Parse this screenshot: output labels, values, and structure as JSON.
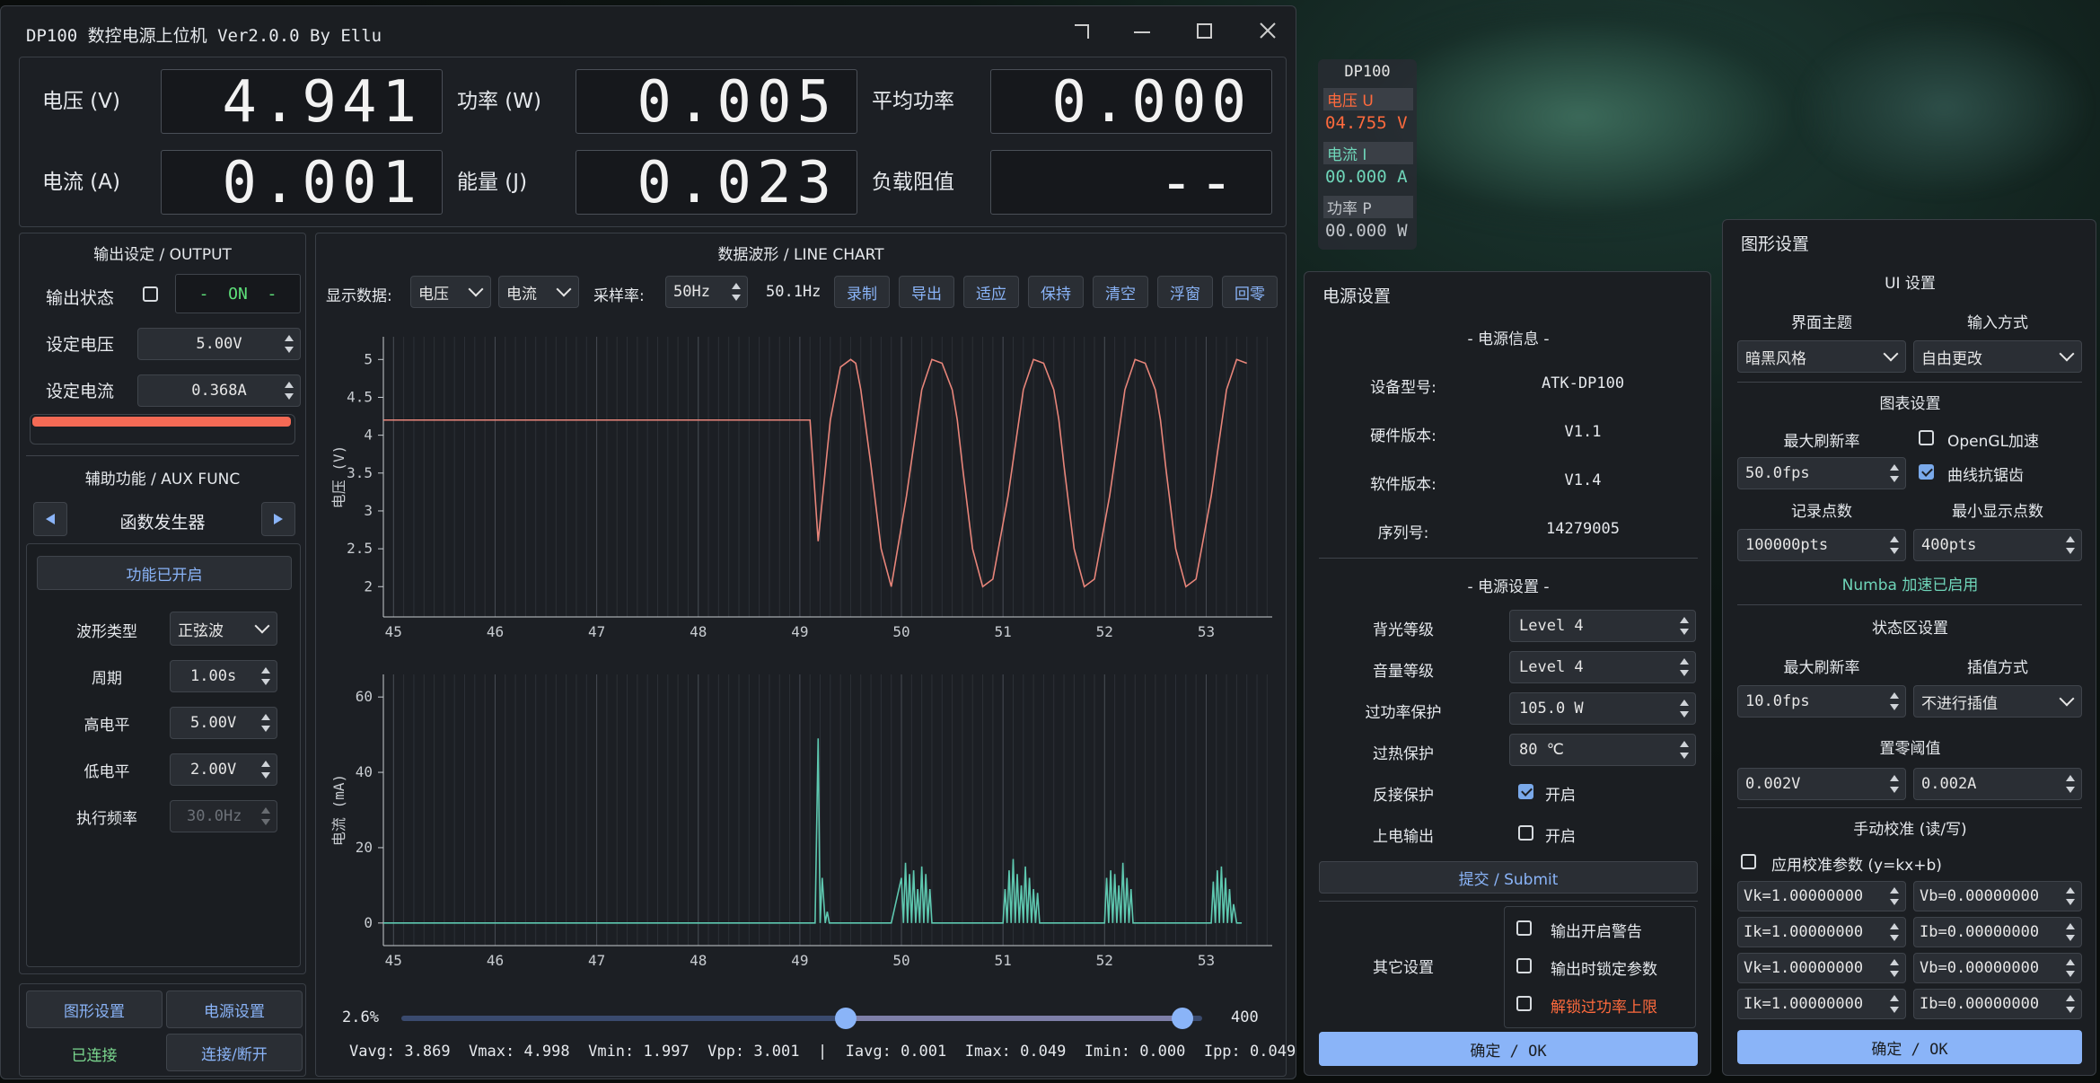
{
  "main_window": {
    "title": "DP100 数控电源上位机 Ver2.0.0 By Ellu",
    "readouts": {
      "voltage_label": "电压 (V)",
      "voltage_value": "4.941",
      "power_label": "功率 (W)",
      "power_value": "0.005",
      "avg_power_label": "平均功率",
      "avg_power_value": "0.000",
      "current_label": "电流 (A)",
      "current_value": "0.001",
      "energy_label": "能量 (J)",
      "energy_value": "0.023",
      "load_label": "负载阻值",
      "load_value": "--"
    },
    "output": {
      "title": "输出设定 / OUTPUT",
      "state_label": "输出状态",
      "state_value": "-  ON  -",
      "set_voltage_label": "设定电压",
      "set_voltage_value": "5.00V",
      "set_current_label": "设定电流",
      "set_current_value": "0.368A"
    },
    "aux": {
      "title": "辅助功能 / AUX FUNC",
      "mode": "函数发生器",
      "enabled_label": "功能已开启",
      "waveform_label": "波形类型",
      "waveform_value": "正弦波",
      "period_label": "周期",
      "period_value": "1.00s",
      "high_label": "高电平",
      "high_value": "5.00V",
      "low_label": "低电平",
      "low_value": "2.00V",
      "freq_label": "执行频率",
      "freq_value": "30.0Hz"
    },
    "bottom_buttons": {
      "graphics": "图形设置",
      "power": "电源设置",
      "connected": "已连接",
      "connect_toggle": "连接/断开"
    },
    "chart_toolbar": {
      "title": "数据波形 / LINE CHART",
      "display_label": "显示数据:",
      "display_a": "电压",
      "display_b": "电流",
      "rate_label": "采样率:",
      "rate_value": "50Hz",
      "rate_actual": "50.1Hz",
      "buttons": [
        "录制",
        "导出",
        "适应",
        "保持",
        "清空",
        "浮窗",
        "回零"
      ]
    },
    "slider": {
      "left_label": "2.6%",
      "right_label": "400",
      "left_frac": 0.016,
      "right_frac": 0.975
    },
    "stats": "Vavg: 3.869  Vmax: 4.998  Vmin: 1.997  Vpp: 3.001  |  Iavg: 0.001  Imax: 0.049  Imin: 0.000  Ipp: 0.049"
  },
  "chart_data": [
    {
      "type": "line",
      "ylabel": "电压 (V)",
      "xlim": [
        44.9,
        53.65
      ],
      "ylim": [
        1.6,
        5.3
      ],
      "xticks": [
        45,
        46,
        47,
        48,
        49,
        50,
        51,
        52,
        53
      ],
      "yticks": [
        2,
        2.5,
        3,
        3.5,
        4,
        4.5,
        5
      ],
      "series": [
        {
          "color": "#e8857a",
          "x": [
            44.9,
            49.1,
            49.13,
            49.18,
            49.3,
            49.4,
            49.5,
            49.55,
            49.6,
            49.7,
            49.8,
            49.9,
            50.05,
            50.2,
            50.3,
            50.4,
            50.5,
            50.55,
            50.6,
            50.7,
            50.8,
            50.9,
            51.05,
            51.2,
            51.3,
            51.4,
            51.5,
            51.55,
            51.6,
            51.7,
            51.8,
            51.9,
            52.05,
            52.2,
            52.3,
            52.4,
            52.5,
            52.55,
            52.6,
            52.7,
            52.8,
            52.9,
            53.05,
            53.2,
            53.3,
            53.4
          ],
          "y": [
            4.2,
            4.2,
            3.6,
            2.6,
            4.2,
            4.9,
            5.0,
            4.95,
            4.6,
            3.6,
            2.5,
            2.0,
            3.2,
            4.6,
            5.0,
            4.95,
            4.6,
            4.2,
            3.6,
            2.5,
            2.0,
            2.1,
            3.2,
            4.6,
            5.0,
            4.95,
            4.6,
            4.2,
            3.6,
            2.5,
            2.0,
            2.1,
            3.2,
            4.6,
            5.0,
            4.95,
            4.6,
            4.2,
            3.6,
            2.5,
            2.0,
            2.1,
            3.2,
            4.6,
            5.0,
            4.95
          ]
        }
      ]
    },
    {
      "type": "line",
      "ylabel": "电流 (mA)",
      "xlim": [
        44.9,
        53.65
      ],
      "ylim": [
        -6,
        66
      ],
      "xticks": [
        45,
        46,
        47,
        48,
        49,
        50,
        51,
        52,
        53
      ],
      "yticks": [
        0,
        20,
        40,
        60
      ],
      "series": [
        {
          "color": "#5ec8b0",
          "x": [
            44.9,
            49.15,
            49.18,
            49.2,
            49.22,
            49.25,
            49.27,
            49.29,
            49.3,
            49.9,
            50.0,
            50.02,
            50.04,
            50.06,
            50.08,
            50.1,
            50.12,
            50.14,
            50.16,
            50.18,
            50.2,
            50.22,
            50.24,
            50.26,
            50.28,
            50.3,
            50.32,
            51.0,
            51.02,
            51.04,
            51.06,
            51.08,
            51.1,
            51.12,
            51.14,
            51.16,
            51.18,
            51.2,
            51.22,
            51.24,
            51.26,
            51.28,
            51.3,
            51.32,
            51.34,
            51.36,
            51.38,
            52.0,
            52.02,
            52.04,
            52.06,
            52.08,
            52.1,
            52.12,
            52.14,
            52.16,
            52.18,
            52.2,
            52.22,
            52.24,
            52.26,
            52.28,
            53.05,
            53.07,
            53.09,
            53.11,
            53.13,
            53.15,
            53.17,
            53.19,
            53.21,
            53.23,
            53.25,
            53.27,
            53.3,
            53.35
          ],
          "y": [
            0,
            0,
            49,
            0,
            12,
            0,
            3,
            0,
            0,
            0,
            12,
            0,
            16,
            0,
            13,
            0,
            14,
            0,
            9,
            0,
            15,
            0,
            13,
            0,
            9,
            0,
            0,
            0,
            9,
            0,
            14,
            0,
            17,
            0,
            13,
            0,
            10,
            0,
            15,
            0,
            12,
            0,
            9,
            0,
            8,
            0,
            0,
            0,
            12,
            0,
            14,
            0,
            13,
            0,
            10,
            0,
            16,
            0,
            12,
            0,
            9,
            0,
            0,
            11,
            0,
            14,
            0,
            15,
            0,
            12,
            0,
            9,
            0,
            5,
            0,
            0
          ]
        }
      ]
    }
  ],
  "overlay": {
    "device": "DP100",
    "v_label": "电压 U",
    "v_value": "04.755 V",
    "i_label": "电流 I",
    "i_value": "00.000 A",
    "p_label": "功率 P",
    "p_value": "00.000 W"
  },
  "power_dialog": {
    "title": "电源设置",
    "info_title": "- 电源信息 -",
    "model_label": "设备型号:",
    "model_value": "ATK-DP100",
    "hw_label": "硬件版本:",
    "hw_value": "V1.1",
    "sw_label": "软件版本:",
    "sw_value": "V1.4",
    "sn_label": "序列号:",
    "sn_value": "14279005",
    "settings_title": "- 电源设置 -",
    "backlight_label": "背光等级",
    "backlight_value": "Level 4",
    "volume_label": "音量等级",
    "volume_value": "Level 4",
    "opp_label": "过功率保护",
    "opp_value": "105.0 W",
    "otp_label": "过热保护",
    "otp_value": "80 ℃",
    "rev_label": "反接保护",
    "rev_check": "开启",
    "poweron_label": "上电输出",
    "poweron_check": "开启",
    "submit": "提交 / Submit",
    "other_label": "其它设置",
    "opt1": "输出开启警告",
    "opt2": "输出时锁定参数",
    "opt3": "解锁过功率上限",
    "ok": "确定 / OK"
  },
  "graphics_dialog": {
    "title": "图形设置",
    "ui_title": "UI 设置",
    "theme_label": "界面主题",
    "input_label": "输入方式",
    "theme_value": "暗黑风格",
    "input_value": "自由更改",
    "chart_title": "图表设置",
    "max_fps_label": "最大刷新率",
    "opengl": "OpenGL加速",
    "max_fps_value": "50.0fps",
    "antialias": "曲线抗锯齿",
    "record_label": "记录点数",
    "min_disp_label": "最小显示点数",
    "record_value": "100000pts",
    "min_disp_value": "400pts",
    "numba": "Numba 加速已启用",
    "status_title": "状态区设置",
    "status_fps_label": "最大刷新率",
    "interp_label": "插值方式",
    "status_fps_value": "10.0fps",
    "interp_value": "不进行插值",
    "zero_title": "置零阈值",
    "zero_v": "0.002V",
    "zero_a": "0.002A",
    "calib_title": "手动校准 (读/写)",
    "calib_apply": "应用校准参数 (y=kx+b)",
    "calib": [
      "Vk=1.00000000",
      "Vb=0.00000000",
      "Ik=1.00000000",
      "Ib=0.00000000",
      "Vk=1.00000000",
      "Vb=0.00000000",
      "Ik=1.00000000",
      "Ib=0.00000000"
    ],
    "ok": "确定 / OK"
  },
  "colors": {
    "accent": "#8ab4f8",
    "wave_v": "#e8857a",
    "wave_i": "#5ec8b0",
    "warn": "#ff6a3d",
    "connected": "#7bd88f"
  }
}
